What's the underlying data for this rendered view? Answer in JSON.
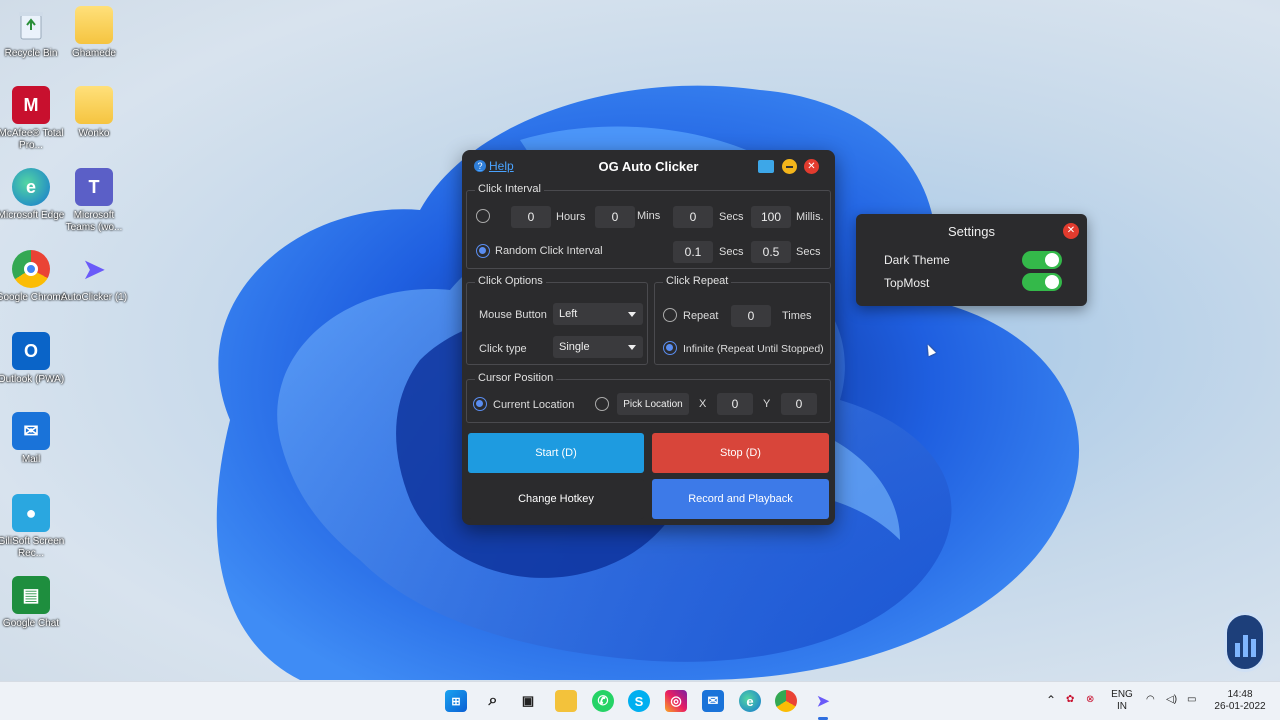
{
  "desktop": {
    "icons": [
      {
        "label": "Recycle Bin"
      },
      {
        "label": "Ghamede"
      },
      {
        "label": "McAfee® Total Pro..."
      },
      {
        "label": "Wonko"
      },
      {
        "label": "Microsoft Edge"
      },
      {
        "label": "Microsoft Teams (wo..."
      },
      {
        "label": "Google Chrome"
      },
      {
        "label": "AutoClicker (1)"
      },
      {
        "label": "Outlook (PWA)"
      },
      {
        "label": "Mail"
      },
      {
        "label": "GiliSoft Screen Rec..."
      },
      {
        "label": "Google Chat"
      }
    ]
  },
  "window": {
    "title": "OG Auto Clicker",
    "help": "Help",
    "click_interval": {
      "title": "Click Interval",
      "hours": "0",
      "hours_label": "Hours",
      "mins": "0",
      "mins_label": "Mins",
      "secs": "0",
      "secs_label": "Secs",
      "millis": "100",
      "millis_label": "Millis.",
      "random_label": "Random Click Interval",
      "random_min": "0.1",
      "random_min_label": "Secs",
      "random_max": "0.5",
      "random_max_label": "Secs"
    },
    "click_options": {
      "title": "Click Options",
      "mouse_button_label": "Mouse Button",
      "mouse_button_value": "Left",
      "click_type_label": "Click type",
      "click_type_value": "Single"
    },
    "click_repeat": {
      "title": "Click Repeat",
      "repeat_label": "Repeat",
      "repeat_value": "0",
      "times_label": "Times",
      "infinite_label": "Infinite (Repeat Until Stopped)"
    },
    "cursor_position": {
      "title": "Cursor Position",
      "current_label": "Current Location",
      "pick_label": "Pick Location",
      "x_label": "X",
      "x_value": "0",
      "y_label": "Y",
      "y_value": "0"
    },
    "buttons": {
      "start": "Start (D)",
      "stop": "Stop (D)",
      "hotkey": "Change Hotkey",
      "record": "Record and Playback"
    },
    "colors": {
      "start": "#1e9be0",
      "stop": "#d8453a",
      "record": "#3d7ae8"
    }
  },
  "settings": {
    "title": "Settings",
    "dark_theme_label": "Dark Theme",
    "dark_theme_on": true,
    "topmost_label": "TopMost",
    "topmost_on": true
  },
  "taskbar": {
    "lang": "ENG",
    "region": "IN",
    "time": "14:48",
    "date": "26-01-2022"
  }
}
